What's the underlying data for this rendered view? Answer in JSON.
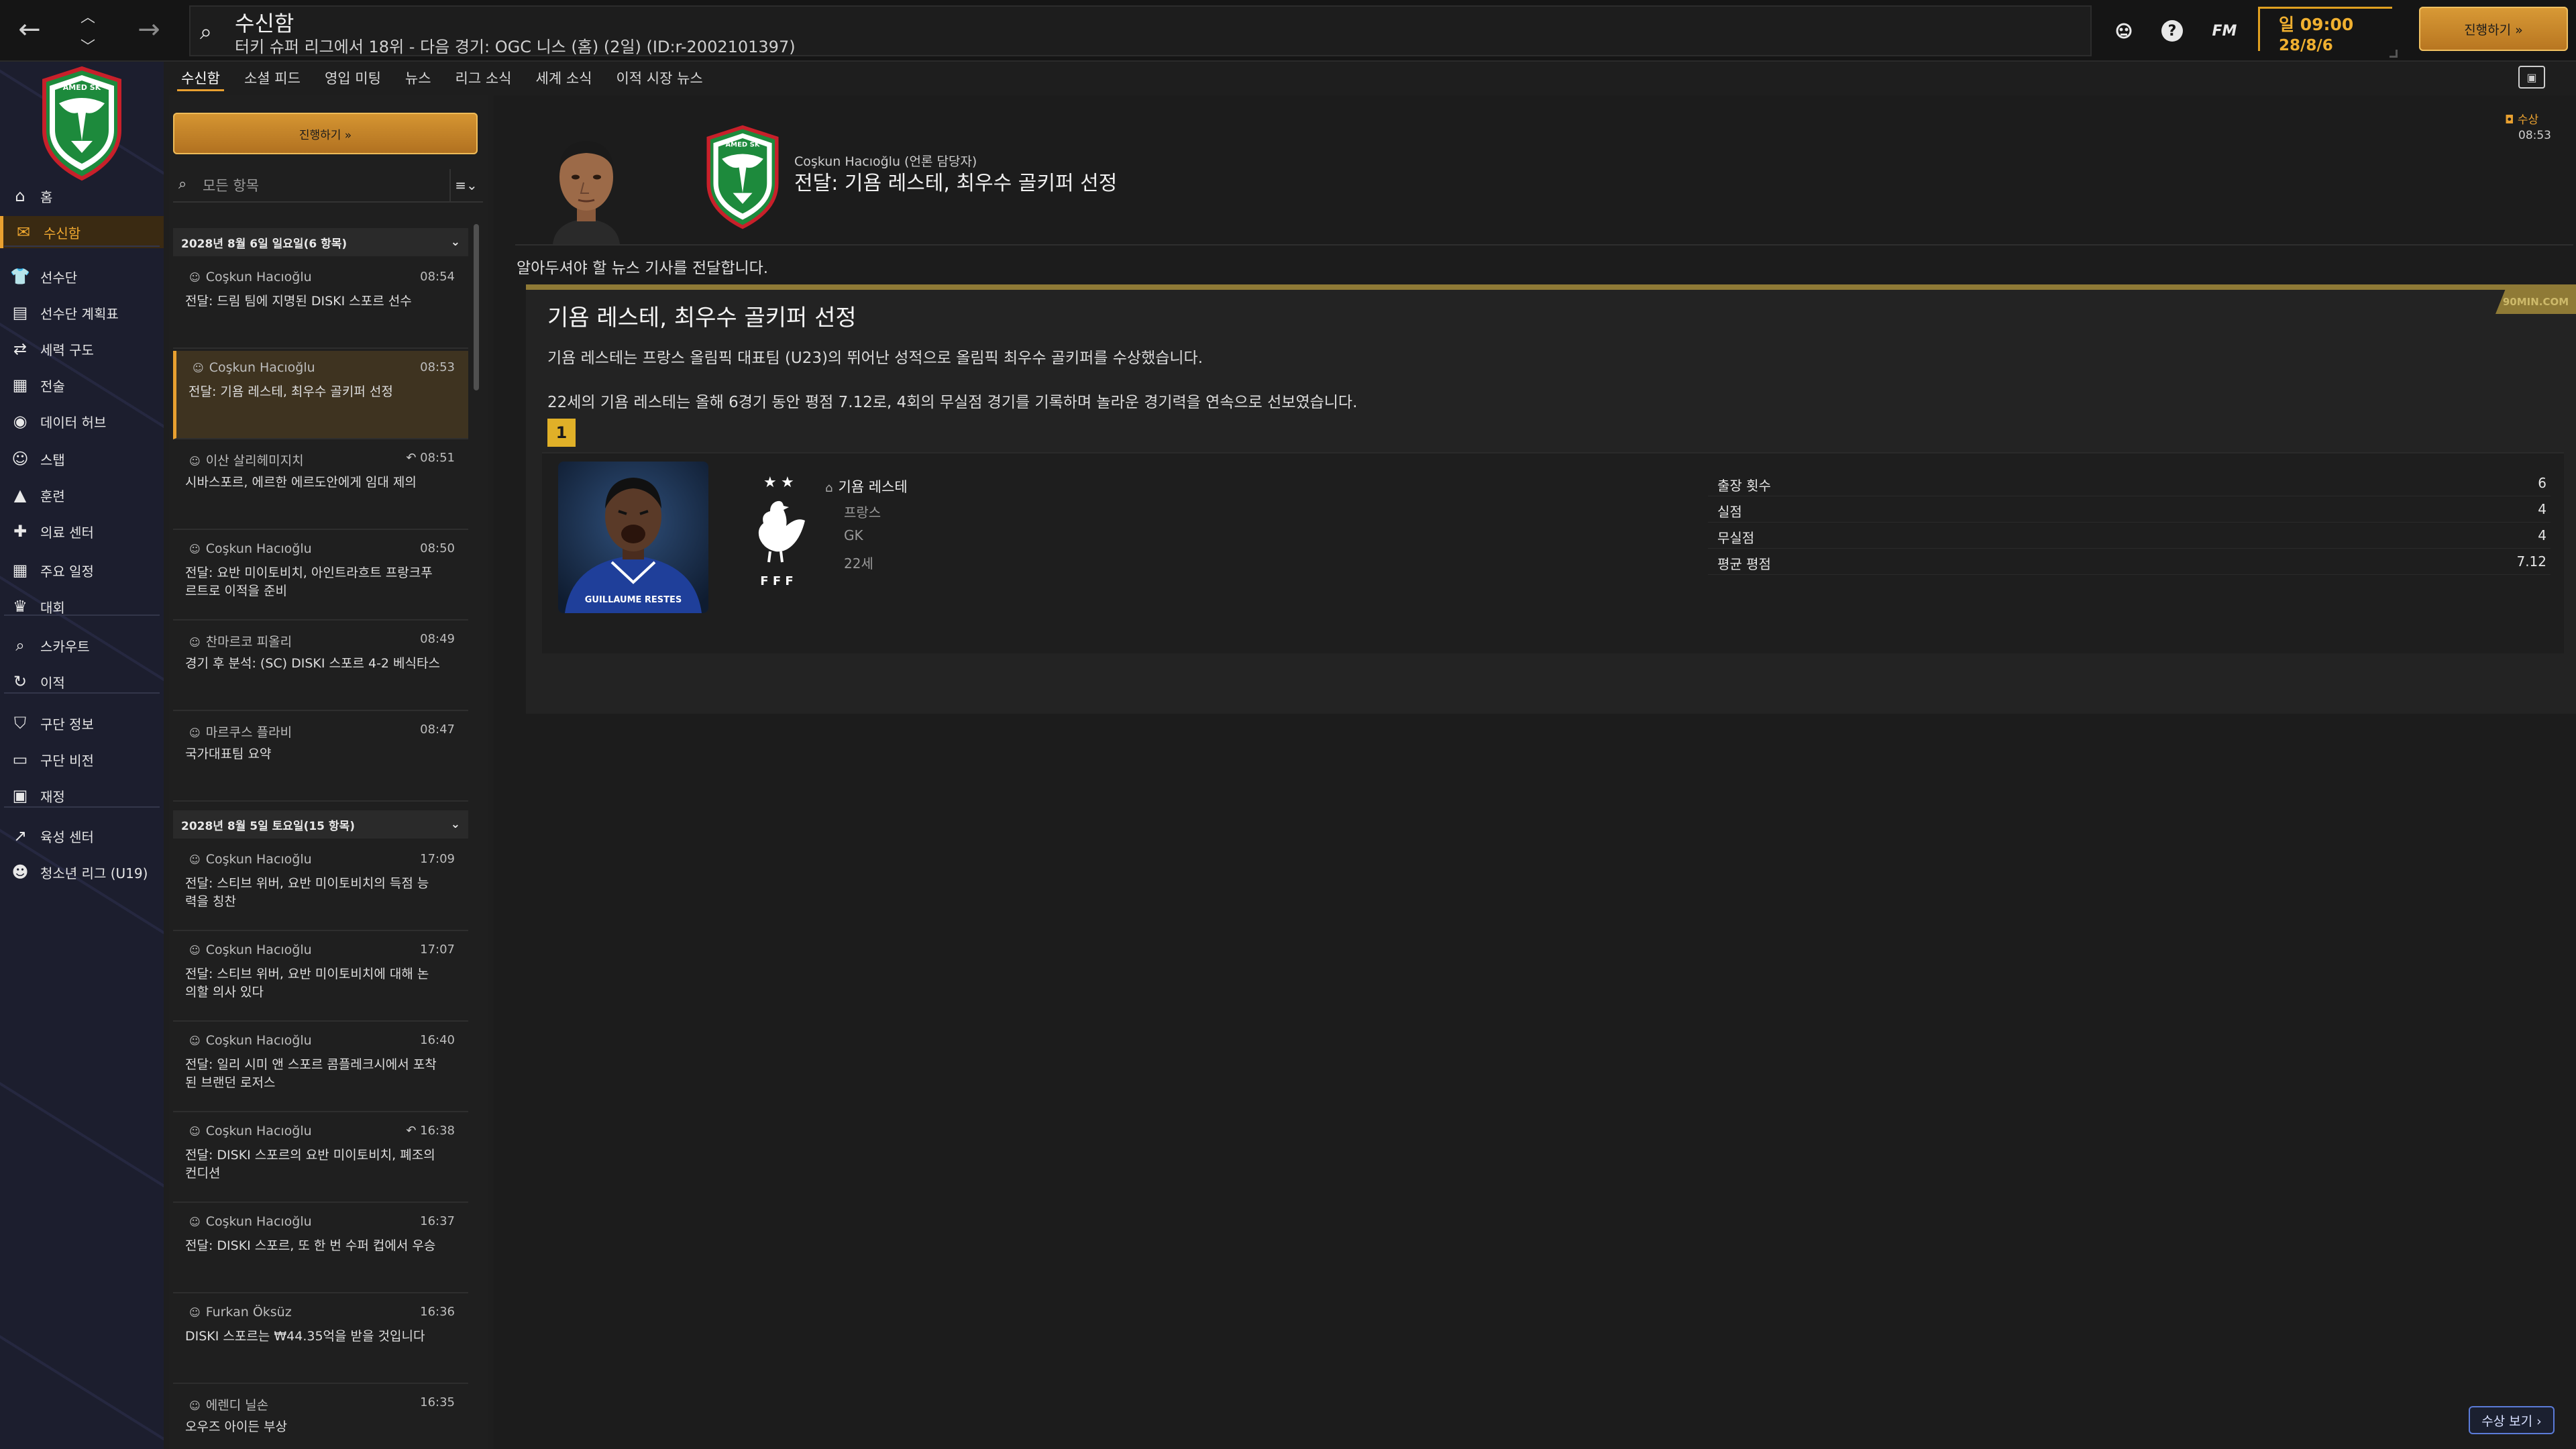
{
  "topbar": {
    "title": "수신함",
    "subtitle": "터키 슈퍼 리그에서 18위 - 다음 경기: OGC 니스 (홈) (2일) (ID:r-2002101397)",
    "fm_logo": "FM",
    "time": "일 09:00",
    "date": "28/8/6",
    "continue_label": "진행하기 »"
  },
  "sidebar": {
    "items": [
      {
        "label": "홈",
        "icon": "home-icon"
      },
      {
        "label": "수신함",
        "icon": "inbox-icon",
        "active": true
      },
      {
        "label": "선수단",
        "icon": "shirt-icon"
      },
      {
        "label": "선수단 계획표",
        "icon": "clipboard-icon"
      },
      {
        "label": "세력 구도",
        "icon": "hierarchy-icon"
      },
      {
        "label": "전술",
        "icon": "tactics-icon"
      },
      {
        "label": "데이터 허브",
        "icon": "data-hub-icon"
      },
      {
        "label": "스탭",
        "icon": "staff-icon"
      },
      {
        "label": "훈련",
        "icon": "training-icon"
      },
      {
        "label": "의료 센터",
        "icon": "medical-icon"
      },
      {
        "label": "주요 일정",
        "icon": "calendar-icon"
      },
      {
        "label": "대회",
        "icon": "trophy-icon"
      },
      {
        "label": "스카우트",
        "icon": "scout-icon"
      },
      {
        "label": "이적",
        "icon": "transfer-icon"
      },
      {
        "label": "구단 정보",
        "icon": "shield-icon"
      },
      {
        "label": "구단 비전",
        "icon": "briefcase-icon"
      },
      {
        "label": "재정",
        "icon": "finance-icon"
      },
      {
        "label": "육성 센터",
        "icon": "development-icon"
      },
      {
        "label": "청소년 리그 (U19)",
        "icon": "youth-icon"
      }
    ]
  },
  "tabs": [
    "수신함",
    "소셜 피드",
    "영입 미팅",
    "뉴스",
    "리그 소식",
    "세계 소식",
    "이적 시장 뉴스"
  ],
  "inbox": {
    "continue_label": "진행하기 »",
    "filter_placeholder": "모든 항목",
    "sort_label": "≡⌄",
    "groups": [
      {
        "header": "2028년 8월 6일 일요일(6 항목)",
        "messages": [
          {
            "sender": "Coşkun Hacıoğlu",
            "time": "08:54",
            "subject": "전달: 드림 팀에 지명된 DISKI 스포르 선수"
          },
          {
            "sender": "Coşkun Hacıoğlu",
            "time": "08:53",
            "subject": "전달: 기욤 레스테, 최우수 골키퍼 선정",
            "selected": true
          },
          {
            "sender": "이산 살리헤미지치",
            "time": "08:51",
            "subject": "시바스포르, 에르한 에르도안에게 임대 제의",
            "reply": true
          },
          {
            "sender": "Coşkun Hacıoğlu",
            "time": "08:50",
            "subject": "전달: 요반 미이토비치, 아인트라흐트 프랑크푸르트로 이적을 준비"
          },
          {
            "sender": "찬마르코 피올리",
            "time": "08:49",
            "subject": "경기 후 분석: (SC) DISKI 스포르 4-2 베식타스"
          },
          {
            "sender": "마르쿠스 플라비",
            "time": "08:47",
            "subject": "국가대표팀 요약"
          }
        ]
      },
      {
        "header": "2028년 8월 5일 토요일(15 항목)",
        "messages": [
          {
            "sender": "Coşkun Hacıoğlu",
            "time": "17:09",
            "subject": "전달: 스티브 위버, 요반 미이토비치의 득점 능력을 칭찬"
          },
          {
            "sender": "Coşkun Hacıoğlu",
            "time": "17:07",
            "subject": "전달: 스티브 위버, 요반 미이토비치에 대해 논의할 의사 있다"
          },
          {
            "sender": "Coşkun Hacıoğlu",
            "time": "16:40",
            "subject": "전달: 일리 시미 앤 스포르 콤플레크시에서 포착된 브랜던 로저스"
          },
          {
            "sender": "Coşkun Hacıoğlu",
            "time": "16:38",
            "subject": "전달: DISKI 스포르의 요반 미이토비치, 폐조의 컨디션",
            "reply": true
          },
          {
            "sender": "Coşkun Hacıoğlu",
            "time": "16:37",
            "subject": "전달: DISKI 스포르, 또 한 번 수퍼 컵에서 우승"
          },
          {
            "sender": "Furkan Öksüz",
            "time": "16:36",
            "subject": "DISKI 스포르는 ₩44.35억을 받을 것입니다"
          },
          {
            "sender": "에렌디 닐손",
            "time": "16:35",
            "subject": "오우즈 아이든 부상"
          }
        ]
      }
    ]
  },
  "detail": {
    "sender": "Coşkun Hacıoğlu",
    "sender_role": "(언론 담당자)",
    "title": "전달: 기욤 레스테, 최우수 골키퍼 선정",
    "tag": "수상",
    "time": "08:53",
    "intro": "알아두셔야 할 뉴스 기사를 전달합니다.",
    "source": "90MIN.COM",
    "article": {
      "headline": "기욤 레스테, 최우수 골키퍼 선정",
      "p1": "기욤 레스테는 프랑스 올림픽 대표팀 (U23)의 뛰어난 성적으로 올림픽 최우수 골키퍼를 수상했습니다.",
      "p2": "22세의 기욤 레스테는 올해 6경기 동안 평점 7.12로, 4회의 무실점 경기를 기록하며 놀라운 경기력을 연속으로 선보였습니다."
    },
    "rank": "1",
    "player": {
      "name": "기욤 레스테",
      "nation": "프랑스",
      "position": "GK",
      "age": "22세",
      "photo_caption": "GUILLAUME RESTES",
      "crest_text": "F F F"
    },
    "stats": [
      {
        "label": "출장 횟수",
        "value": "6"
      },
      {
        "label": "실점",
        "value": "4"
      },
      {
        "label": "무실점",
        "value": "4"
      },
      {
        "label": "평균 평점",
        "value": "7.12"
      }
    ],
    "awards_button": "수상 보기 ›"
  },
  "colors": {
    "accent": "#e8a030",
    "sidebar": "#1c1e2e",
    "club_green": "#1d8a3c",
    "club_red": "#c8202a"
  }
}
